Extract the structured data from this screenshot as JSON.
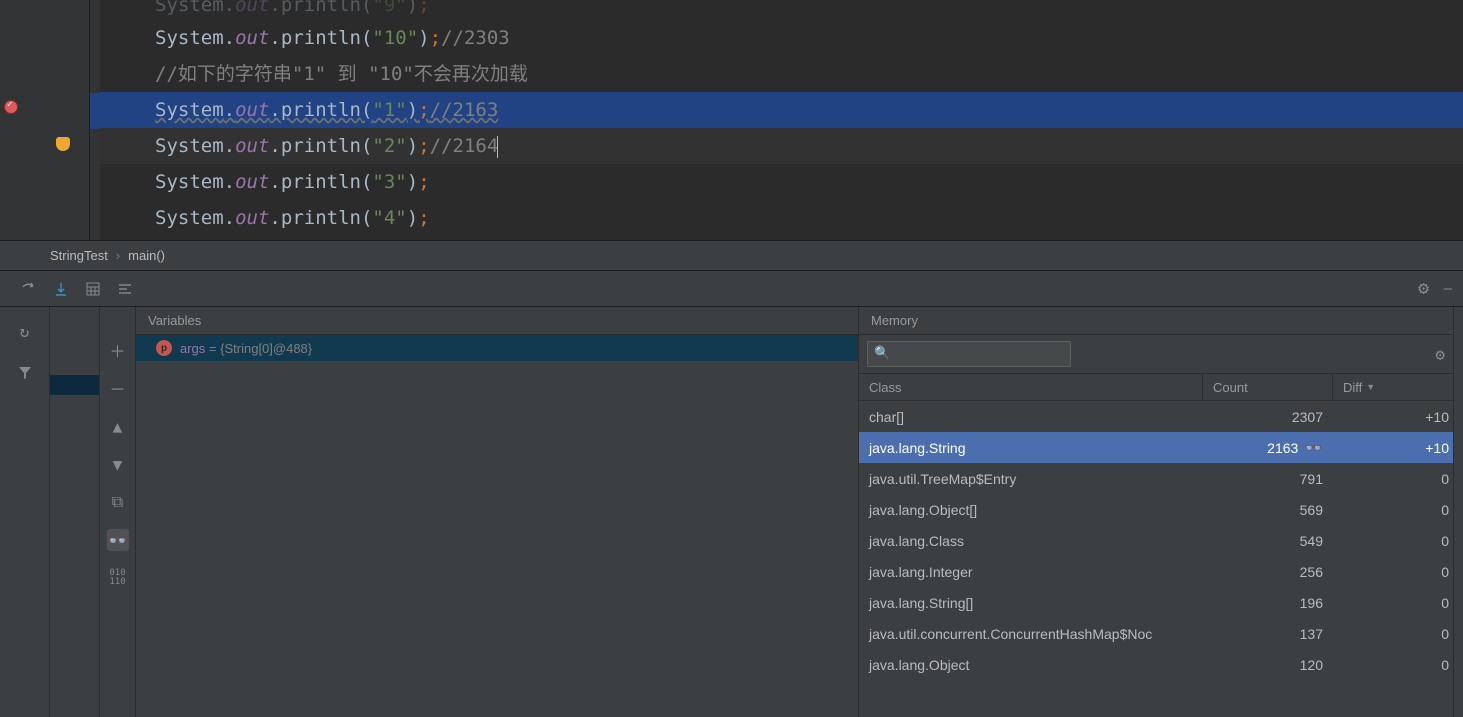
{
  "editor": {
    "lines": [
      {
        "class": "System",
        "field": "out",
        "method": "println",
        "arg": "\"9\"",
        "tail": ";",
        "comment": "",
        "faded": true
      },
      {
        "class": "System",
        "field": "out",
        "method": "println",
        "arg": "\"10\"",
        "tail": ";",
        "comment": "//2303"
      },
      {
        "comment_only": "//如下的字符串\"1\" 到 \"10\"不会再次加载"
      },
      {
        "class": "System",
        "field": "out",
        "method": "println",
        "arg": "\"1\"",
        "tail": ";",
        "comment": "//2163",
        "highlight": true,
        "wavy": true
      },
      {
        "class": "System",
        "field": "out",
        "method": "println",
        "arg": "\"2\"",
        "tail": ";",
        "comment": "//2164",
        "current": true,
        "caret": true
      },
      {
        "class": "System",
        "field": "out",
        "method": "println",
        "arg": "\"3\"",
        "tail": ";",
        "comment": ""
      },
      {
        "class": "System",
        "field": "out",
        "method": "println",
        "arg": "\"4\"",
        "tail": ";",
        "comment": ""
      }
    ]
  },
  "breadcrumb": {
    "class": "StringTest",
    "method": "main()"
  },
  "variables": {
    "tab": "Variables",
    "rows": [
      {
        "icon": "p",
        "name": "args",
        "value": "{String[0]@488}"
      }
    ]
  },
  "memory": {
    "tab": "Memory",
    "search_placeholder": "",
    "columns": {
      "class": "Class",
      "count": "Count",
      "diff": "Diff"
    },
    "rows": [
      {
        "class": "char[]",
        "count": "2307",
        "diff": "+10",
        "selected": false
      },
      {
        "class": "java.lang.String",
        "count": "2163",
        "diff": "+10",
        "selected": true,
        "watched": true
      },
      {
        "class": "java.util.TreeMap$Entry",
        "count": "791",
        "diff": "0"
      },
      {
        "class": "java.lang.Object[]",
        "count": "569",
        "diff": "0"
      },
      {
        "class": "java.lang.Class",
        "count": "549",
        "diff": "0"
      },
      {
        "class": "java.lang.Integer",
        "count": "256",
        "diff": "0"
      },
      {
        "class": "java.lang.String[]",
        "count": "196",
        "diff": "0"
      },
      {
        "class": "java.util.concurrent.ConcurrentHashMap$Noc",
        "count": "137",
        "diff": "0"
      },
      {
        "class": "java.lang.Object",
        "count": "120",
        "diff": "0"
      }
    ]
  }
}
